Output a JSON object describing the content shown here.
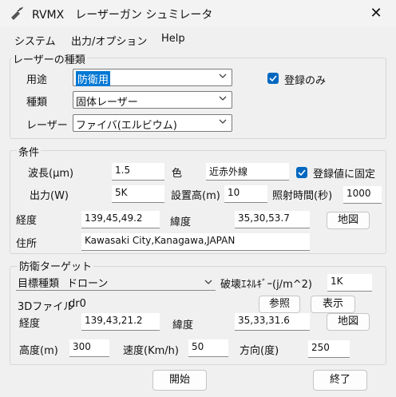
{
  "window": {
    "title": "RVMX　レーザーガン シュミレータ",
    "close_glyph": "✕",
    "icon": "laser-gun-icon"
  },
  "menu": [
    "システム",
    "出力/オプション",
    "Help"
  ],
  "laser_type": {
    "legend": "レーザーの種類",
    "use_label": "用途",
    "use_value": "防衛用",
    "kind_label": "種類",
    "kind_value": "固体レーザー",
    "laser_label": "レーザー",
    "laser_value": "ファイバ(エルビウム)",
    "register_only_label": "登録のみ",
    "register_only_checked": true
  },
  "conditions": {
    "legend": "条件",
    "wavelength_label": "波長(μm)",
    "wavelength_value": "1.5",
    "color_label": "色",
    "color_value": "近赤外線",
    "fix_registered_label": "登録値に固定",
    "fix_registered_checked": true,
    "output_label": "出力(W)",
    "output_value": "5K",
    "install_height_label": "設置高(m)",
    "install_height_value": "10",
    "irradiation_time_label": "照射時間(秒)",
    "irradiation_time_value": "1000",
    "longitude_label": "経度",
    "longitude_value": "139,45,49.2",
    "latitude_label": "緯度",
    "latitude_value": "35,30,53.7",
    "map_button": "地図",
    "address_label": "住所",
    "address_value": "Kawasaki City,Kanagawa,JAPAN"
  },
  "target": {
    "legend": "防衛ターゲット",
    "target_type_label": "目標種類",
    "target_type_value": "ドローン",
    "destruction_energy_label": "破壊ｴﾈﾙｷﾞｰ(j/m^2)",
    "destruction_energy_value": "1K",
    "file_label": "3Dファイル",
    "file_value": "dr0",
    "browse_button": "参照",
    "display_button": "表示",
    "longitude_label": "経度",
    "longitude_value": "139,43,21.2",
    "latitude_label": "緯度",
    "latitude_value": "35,33,31.6",
    "map_button": "地図",
    "altitude_label": "高度(m)",
    "altitude_value": "300",
    "speed_label": "速度(Km/h)",
    "speed_value": "50",
    "direction_label": "方向(度)",
    "direction_value": "250"
  },
  "footer": {
    "start_button": "開始",
    "end_button": "終了"
  }
}
